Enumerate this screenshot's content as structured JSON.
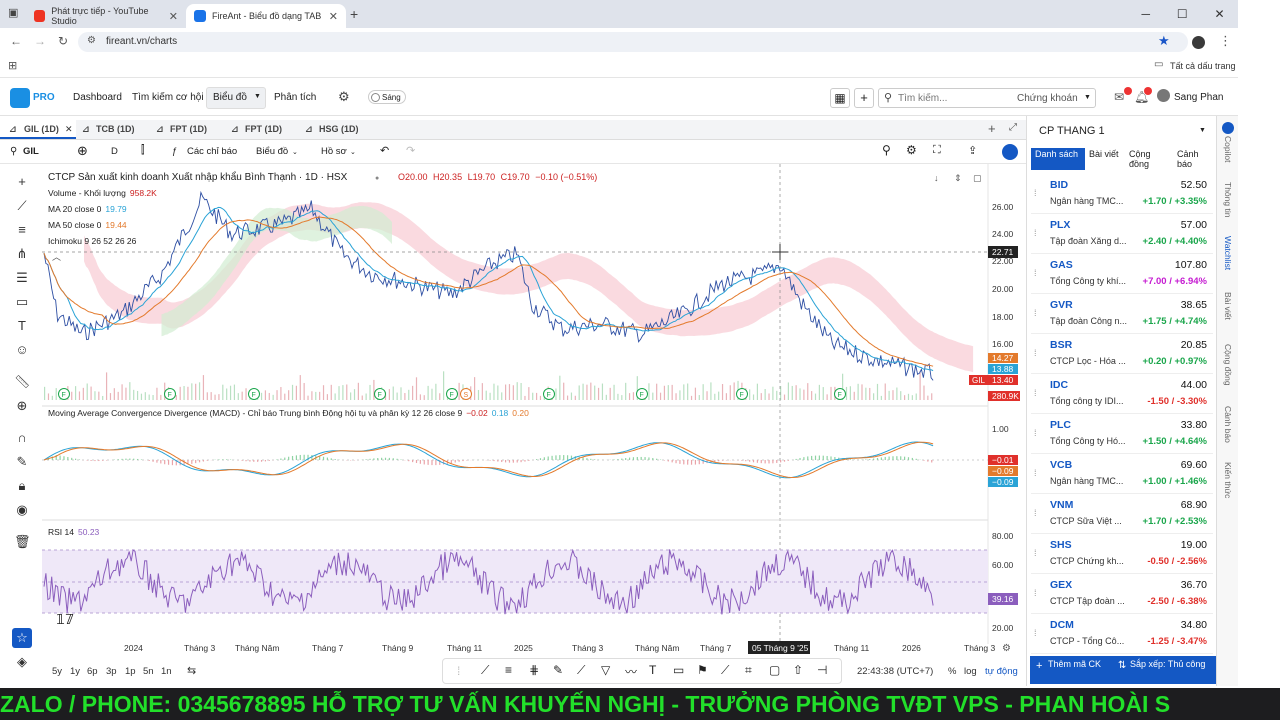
{
  "browser": {
    "tabs": [
      {
        "label": "Phát trực tiếp - YouTube Studio"
      },
      {
        "label": "FireAnt - Biểu đồ dạng TAB"
      }
    ],
    "url": "fireant.vn/charts",
    "bookmarks_all": "Tất cả dấu trang"
  },
  "app": {
    "pro": "PRO",
    "nav": [
      "Dashboard",
      "Tìm kiếm cơ hội",
      "Biểu đồ",
      "Phân tích"
    ],
    "theme": "Sáng",
    "search_placeholder": "Tìm kiếm...",
    "search_scope": "Chứng khoán",
    "user": "Sang Phan"
  },
  "chart_tabs": [
    "GIL (1D)",
    "TCB (1D)",
    "FPT (1D)",
    "FPT (1D)",
    "HSG (1D)"
  ],
  "toolbar": {
    "symbol": "GIL",
    "interval": "D",
    "indicators": "Các chỉ báo",
    "chart_type": "Biểu đồ",
    "profile": "Hồ sơ"
  },
  "legend": {
    "title": "CTCP Sản xuất kinh doanh Xuất nhập khẩu Bình Thạnh · 1D · HSX",
    "ohlc": [
      "O20.00",
      "H20.35",
      "L19.70",
      "C19.70",
      "−0.10 (−0.51%)"
    ],
    "volume": "Volume - Khối lượng",
    "volume_val": "958.2K",
    "ma20": "MA 20 close 0",
    "ma20_val": "19.79",
    "ma50": "MA 50 close 0",
    "ma50_val": "19.44",
    "ichimoku": "Ichimoku 9 26 52 26 26",
    "macd": "Moving Average Convergence Divergence (MACD) - Chỉ báo Trung bình Động hội tụ và phân kỳ 12 26 close 9",
    "macd_vals": [
      "−0.02",
      "0.18",
      "0.20"
    ],
    "rsi": "RSI 14",
    "rsi_val": "50.23"
  },
  "colors": {
    "accent": "#1458c4",
    "up": "#1aa64b",
    "down": "#e0302b",
    "ceiling": "#c51bd1",
    "price_line": "#2e4fa3",
    "ma20": "#2aa3d6",
    "ma50": "#e37a2c",
    "rsi": "#8b5ebd"
  },
  "price_axis": [
    "26.00",
    "24.00",
    "22.00",
    "20.00",
    "18.00",
    "16.00"
  ],
  "price_badges": {
    "cursor": "22.71",
    "ma50": "14.27",
    "ma20": "13.88",
    "last": "13.40",
    "sym": "GIL",
    "vol": "280.9K"
  },
  "macd_axis": [
    "1.00",
    "−0.01",
    "−0.09",
    "−0.09"
  ],
  "rsi_axis": [
    "80.00",
    "60.00",
    "39.16",
    "20.00"
  ],
  "time_axis": [
    "2024",
    "Tháng 3",
    "Tháng Năm",
    "Tháng 7",
    "Tháng 9",
    "Tháng 11",
    "2025",
    "Tháng 3",
    "Tháng Năm",
    "Tháng 7",
    "05 Tháng 9 '25",
    "Tháng 11",
    "2026",
    "Tháng 3"
  ],
  "bottom_toolbar": {
    "timeframes": [
      "5y",
      "1y",
      "6p",
      "3p",
      "1p",
      "5n",
      "1n"
    ],
    "clock": "22:43:38 (UTC+7)",
    "pct": "%",
    "log": "log",
    "auto": "tự động"
  },
  "watchlist": {
    "title": "CP THANG 1",
    "tabs": [
      "Danh sách",
      "Bài viết",
      "Cộng đồng",
      "Cảnh báo"
    ],
    "items": [
      {
        "sym": "BID",
        "name": "Ngân hàng TMC...",
        "price": "52.50",
        "chg": "+1.70 / +3.35%",
        "dir": "up"
      },
      {
        "sym": "PLX",
        "name": "Tập đoàn Xăng d...",
        "price": "57.00",
        "chg": "+2.40 / +4.40%",
        "dir": "up"
      },
      {
        "sym": "GAS",
        "name": "Tổng Công ty khí...",
        "price": "107.80",
        "chg": "+7.00 / +6.94%",
        "dir": "ceil"
      },
      {
        "sym": "GVR",
        "name": "Tập đoàn Công n...",
        "price": "38.65",
        "chg": "+1.75 / +4.74%",
        "dir": "up"
      },
      {
        "sym": "BSR",
        "name": "CTCP Lọc - Hóa ...",
        "price": "20.85",
        "chg": "+0.20 / +0.97%",
        "dir": "up"
      },
      {
        "sym": "IDC",
        "name": "Tổng công ty IDI...",
        "price": "44.00",
        "chg": "-1.50 / -3.30%",
        "dir": "down"
      },
      {
        "sym": "PLC",
        "name": "Tổng Công ty Hó...",
        "price": "33.80",
        "chg": "+1.50 / +4.64%",
        "dir": "up"
      },
      {
        "sym": "VCB",
        "name": "Ngân hàng TMC...",
        "price": "69.60",
        "chg": "+1.00 / +1.46%",
        "dir": "up"
      },
      {
        "sym": "VNM",
        "name": "CTCP Sữa Việt ...",
        "price": "68.90",
        "chg": "+1.70 / +2.53%",
        "dir": "up"
      },
      {
        "sym": "SHS",
        "name": "CTCP Chứng kh...",
        "price": "19.00",
        "chg": "-0.50 / -2.56%",
        "dir": "down"
      },
      {
        "sym": "GEX",
        "name": "CTCP Tập đoàn ...",
        "price": "36.70",
        "chg": "-2.50 / -6.38%",
        "dir": "down"
      },
      {
        "sym": "DCM",
        "name": "CTCP - Tổng Cô...",
        "price": "34.80",
        "chg": "-1.25 / -3.47%",
        "dir": "down"
      }
    ],
    "add_stock": "Thêm mã CK",
    "sort": "Sắp xếp: Thủ công"
  },
  "side_tabs": [
    "Copilot",
    "Thông tin",
    "Watchlist",
    "Bài viết",
    "Cộng đồng",
    "Cảnh báo",
    "Kiến thức"
  ],
  "ticker": "ZALO / PHONE: 0345678895          HỖ TRỢ TƯ VẤN KHUYẾN NGHỊ - TRƯỞNG PHÒNG TVĐT VPS - PHAN HOÀI S"
}
